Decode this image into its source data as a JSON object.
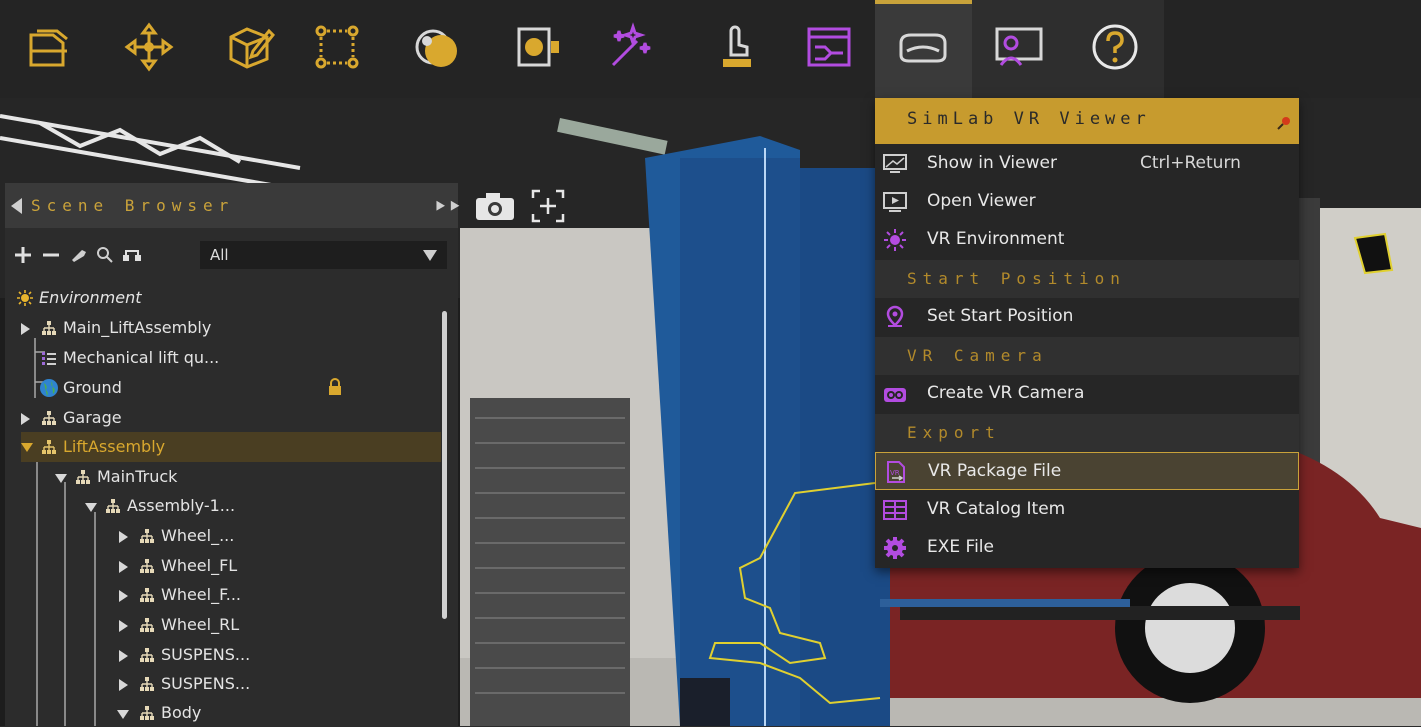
{
  "toolbar": {
    "buttons": [
      {
        "name": "open-file-icon"
      },
      {
        "name": "transform-icon"
      },
      {
        "name": "edit-object-icon"
      },
      {
        "name": "selection-box-icon"
      },
      {
        "name": "materials-icon"
      },
      {
        "name": "render-icon"
      },
      {
        "name": "effects-magic-icon"
      },
      {
        "name": "interaction-icon"
      },
      {
        "name": "scene-states-icon"
      },
      {
        "name": "vr-headset-icon"
      },
      {
        "name": "presentation-icon"
      },
      {
        "name": "help-icon"
      }
    ],
    "accent": "#c8a23a"
  },
  "scene_browser": {
    "title": "Scene Browser",
    "filter_value": "All",
    "items": [
      {
        "label": "Environment",
        "italic": true,
        "indent": 0,
        "arrow": "none",
        "icon": "sun-icon"
      },
      {
        "label": "Main_LiftAssembly",
        "indent": 0,
        "arrow": "right",
        "icon": "hierarchy-icon"
      },
      {
        "label": "Mechanical lift qu...",
        "indent": 0,
        "arrow": "branch",
        "icon": "list-icon"
      },
      {
        "label": "Ground",
        "indent": 0,
        "arrow": "branch",
        "icon": "globe-icon",
        "locked": true
      },
      {
        "label": "Garage",
        "indent": 0,
        "arrow": "right",
        "icon": "hierarchy-icon"
      },
      {
        "label": "LiftAssembly",
        "indent": 0,
        "arrow": "down",
        "icon": "hierarchy-icon",
        "selected": true
      },
      {
        "label": "MainTruck",
        "indent": 1,
        "arrow": "down",
        "icon": "hierarchy-icon"
      },
      {
        "label": "Assembly-1...",
        "indent": 2,
        "arrow": "down",
        "icon": "hierarchy-icon"
      },
      {
        "label": "Wheel_...",
        "indent": 3,
        "arrow": "right",
        "icon": "hierarchy-icon"
      },
      {
        "label": "Wheel_FL",
        "indent": 3,
        "arrow": "right",
        "icon": "hierarchy-icon"
      },
      {
        "label": "Wheel_F...",
        "indent": 3,
        "arrow": "right",
        "icon": "hierarchy-icon"
      },
      {
        "label": "Wheel_RL",
        "indent": 3,
        "arrow": "right",
        "icon": "hierarchy-icon"
      },
      {
        "label": "SUSPENS...",
        "indent": 3,
        "arrow": "right",
        "icon": "hierarchy-icon"
      },
      {
        "label": "SUSPENS...",
        "indent": 3,
        "arrow": "right",
        "icon": "hierarchy-icon"
      },
      {
        "label": "Body",
        "indent": 3,
        "arrow": "down",
        "icon": "hierarchy-icon"
      }
    ]
  },
  "vr_menu": {
    "title": "SimLab VR Viewer",
    "show_in_viewer": "Show in Viewer",
    "show_in_viewer_shortcut": "Ctrl+Return",
    "open_viewer": "Open Viewer",
    "vr_environment": "VR Environment",
    "section_start_position": "Start Position",
    "set_start_position": "Set Start Position",
    "section_vr_camera": "VR Camera",
    "create_vr_camera": "Create VR Camera",
    "section_export": "Export",
    "vr_package_file": "VR Package File",
    "vr_catalog_item": "VR Catalog Item",
    "exe_file": "EXE File"
  }
}
